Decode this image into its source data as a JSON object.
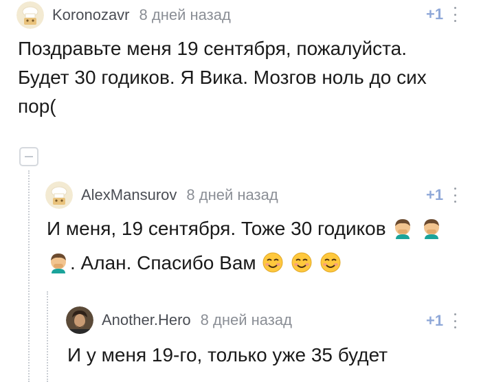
{
  "comments": [
    {
      "author": "Koronozavr",
      "timestamp": "8 дней назад",
      "rating": "+1",
      "lines": [
        "Поздравьте меня 19 сентября, пожалуйста.",
        "Будет 30 годиков. Я Вика. Мозгов ноль до сих",
        "пор("
      ]
    },
    {
      "author": "AlexMansurov",
      "timestamp": "8 дней назад",
      "rating": "+1",
      "line1": "И меня, 19 сентября. Тоже 30 годиков",
      "line2": ". Алан. Спасибо Вам"
    },
    {
      "author": "Another.Hero",
      "timestamp": "8 дней назад",
      "rating": "+1",
      "line1": "И у меня 19-го, только уже 35 будет"
    }
  ],
  "icons": {
    "default_avatar": "chef-hat-avatar-icon",
    "user_avatar": "bearded-man-avatar-icon",
    "facepalm": "man-facepalming-emoji",
    "smile": "smiling-face-emoji",
    "more": "more-vertical-icon",
    "collapse": "collapse-minus-icon"
  },
  "colors": {
    "rating": "#8fa8d8",
    "author": "#4a4d54",
    "timestamp": "#8a8e95",
    "thread_line": "#c9cdd3"
  }
}
